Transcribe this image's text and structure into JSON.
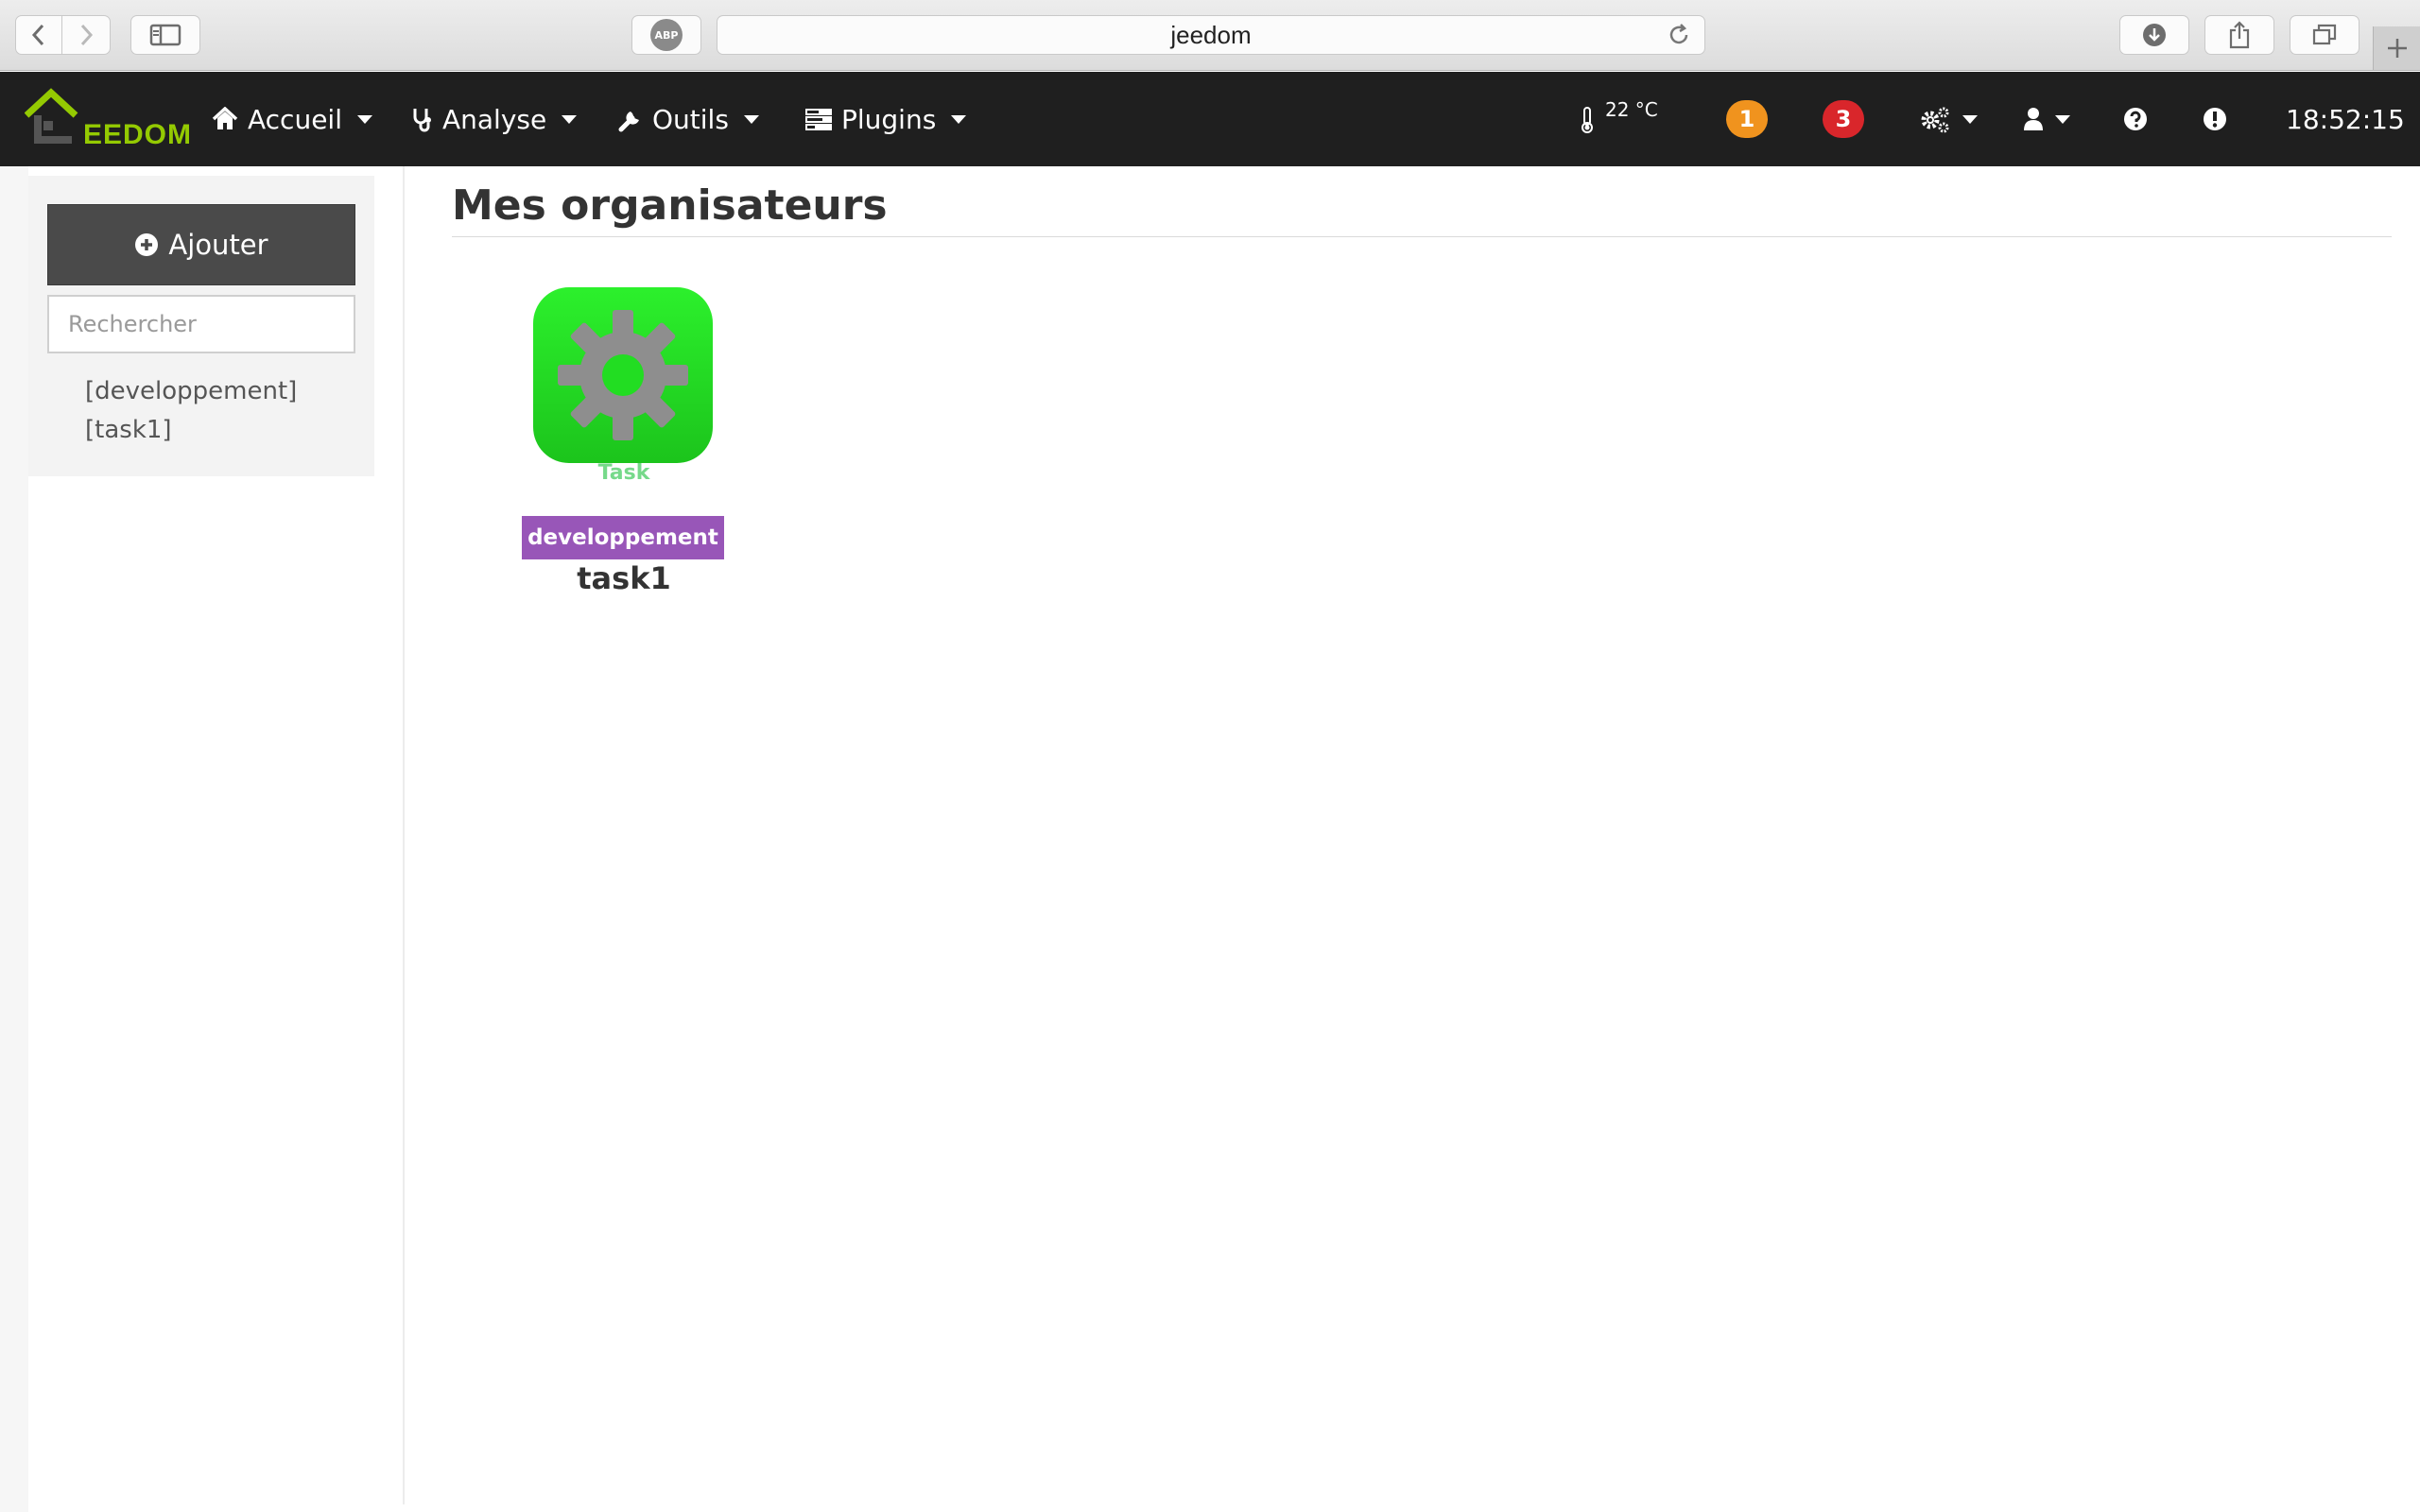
{
  "browser": {
    "url": "jeedom",
    "adblock_label": "ABP"
  },
  "navbar": {
    "logo_text": "EEDOM",
    "menu": [
      {
        "label": "Accueil",
        "icon": "home-icon"
      },
      {
        "label": "Analyse",
        "icon": "stethoscope-icon"
      },
      {
        "label": "Outils",
        "icon": "wrench-icon"
      },
      {
        "label": "Plugins",
        "icon": "tasks-icon"
      }
    ],
    "temperature": "22 °C",
    "warning_count": "1",
    "error_count": "3",
    "time": "18:52:15",
    "colors": {
      "bar": "#1f1f1f",
      "warning": "#f0931e",
      "error": "#d9262b",
      "brand": "#94ca02"
    }
  },
  "sidebar": {
    "add_label": "Ajouter",
    "search_placeholder": "Rechercher",
    "items": [
      {
        "label": "[developpement]"
      },
      {
        "label": "[task1]"
      }
    ]
  },
  "main": {
    "title": "Mes organisateurs",
    "cards": [
      {
        "icon": "gear-icon",
        "subtitle": "Task",
        "tag": "developpement",
        "name": "task1",
        "tag_color": "#9856b8",
        "icon_color": "#22dd22"
      }
    ]
  }
}
